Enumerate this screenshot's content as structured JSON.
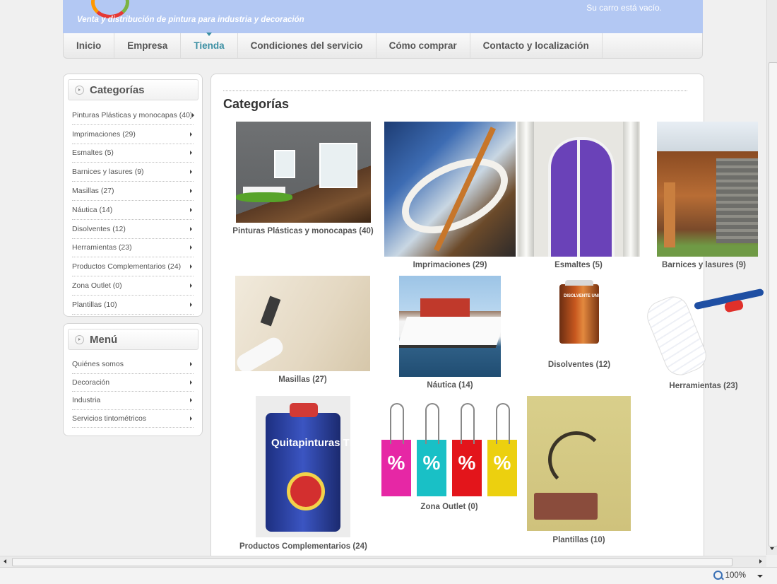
{
  "header": {
    "tagline": "Venta y distribución de pintura para industria y decoración",
    "cart": "Su carro está vacío.",
    "brand_color": "#b3c8f3"
  },
  "nav": {
    "items": [
      {
        "label": "Inicio",
        "active": false
      },
      {
        "label": "Empresa",
        "active": false
      },
      {
        "label": "Tienda",
        "active": true
      },
      {
        "label": "Condiciones del servicio",
        "active": false
      },
      {
        "label": "Cómo comprar",
        "active": false
      },
      {
        "label": "Contacto y localización",
        "active": false
      }
    ],
    "active_color": "#3b8fa3"
  },
  "sidebar": {
    "categories_title": "Categorías",
    "categories": [
      "Pinturas Plásticas y monocapas (40)",
      "Imprimaciones (29)",
      "Esmaltes (5)",
      "Barnices y lasures (9)",
      "Masillas (27)",
      "Náutica (14)",
      "Disolventes (12)",
      "Herramientas (23)",
      "Productos Complementarios (24)",
      "Zona Outlet (0)",
      "Plantillas (10)"
    ],
    "menu_title": "Menú",
    "menu": [
      "Quiénes somos",
      "Decoración",
      "Industria",
      "Servicios tintométricos"
    ]
  },
  "main": {
    "title": "Categorías",
    "categories": [
      {
        "label": "Pinturas Plásticas y monocapas (40)",
        "image": "living-room"
      },
      {
        "label": "Imprimaciones (29)",
        "image": "pipe-primer"
      },
      {
        "label": "Esmaltes (5)",
        "image": "purple-door"
      },
      {
        "label": "Barnices y lasures (9)",
        "image": "wood-cabin"
      },
      {
        "label": "Masillas (27)",
        "image": "plaster-wall"
      },
      {
        "label": "Náutica (14)",
        "image": "boat"
      },
      {
        "label": "Disolventes (12)",
        "image": "solvent-can"
      },
      {
        "label": "Herramientas (23)",
        "image": "paint-roller"
      },
      {
        "label": "Productos Complementarios (24)",
        "image": "paint-stripper-tin"
      },
      {
        "label": "Zona Outlet (0)",
        "image": "percent-tags"
      },
      {
        "label": "Plantillas (10)",
        "image": "stencil"
      }
    ],
    "tin_text": "Quitapinturas TITAN",
    "can_text": "DISOLVENTE UNIVERSAL",
    "tag_symbol": "%"
  },
  "status": {
    "zoom": "100%"
  }
}
